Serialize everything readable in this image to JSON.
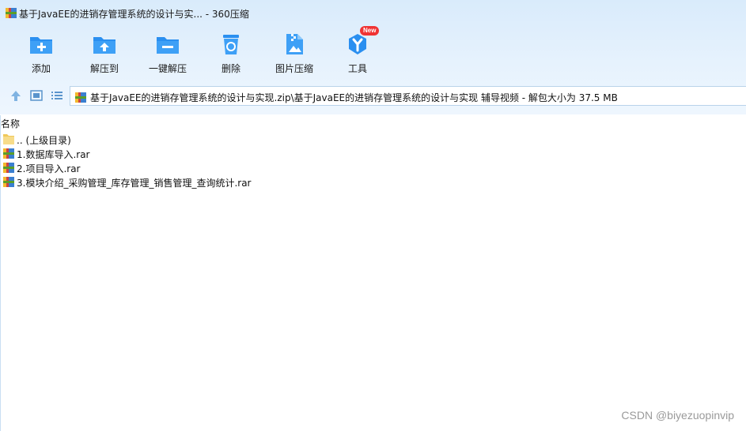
{
  "window": {
    "title": "基于JavaEE的进销存管理系统的设计与实... - 360压缩"
  },
  "toolbar": {
    "items": [
      {
        "label": "添加",
        "icon": "folder-add-icon"
      },
      {
        "label": "解压到",
        "icon": "folder-extract-icon"
      },
      {
        "label": "一键解压",
        "icon": "folder-one-click-extract-icon"
      },
      {
        "label": "删除",
        "icon": "recycle-bin-icon"
      },
      {
        "label": "图片压缩",
        "icon": "image-compress-icon"
      },
      {
        "label": "工具",
        "icon": "tools-icon"
      }
    ],
    "badge": "New"
  },
  "navbar": {
    "path": "基于JavaEE的进销存管理系统的设计与实现.zip\\基于JavaEE的进销存管理系统的设计与实现 辅导视频 - 解包大小为 37.5 MB"
  },
  "columns": {
    "name": "名称"
  },
  "files": [
    {
      "name": ".. (上级目录)",
      "icon": "folder-icon"
    },
    {
      "name": "1.数据库导入.rar",
      "icon": "rar-archive-icon"
    },
    {
      "name": "2.项目导入.rar",
      "icon": "rar-archive-icon"
    },
    {
      "name": "3.模块介绍_采购管理_库存管理_销售管理_查询统计.rar",
      "icon": "rar-archive-icon"
    }
  ],
  "watermark": "CSDN @biyezuopinvip",
  "colors": {
    "accent": "#2a8ff0",
    "toolbar_bg": "#e3effb",
    "badge": "#f03333"
  }
}
